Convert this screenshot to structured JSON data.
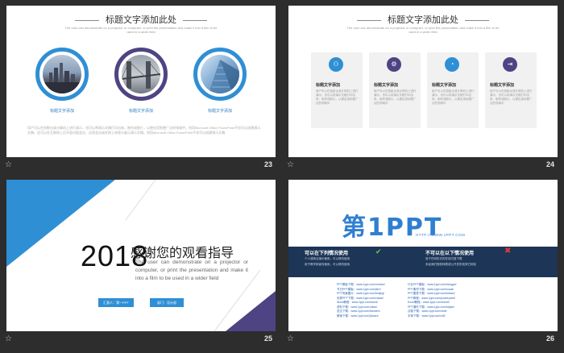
{
  "slides": [
    {
      "number": "23",
      "title": "标题文字添加此处",
      "subtitle": "The user can demonstrate on a projector or computer, or print the presentation and make it into a film to be used in a wider field",
      "captions": [
        "标题文字添加",
        "标题文字添加",
        "标题文字添加"
      ],
      "paragraph": "用户可以在投影仪或计算机上进行演示，也可以将演示文稿打印出来，制作成胶片，以便应用到更广泛的领域中。利用Microsoft Office PowerPoint不仅可以创建演示文稿，还可以在互联网上召开面对面会议、远程会议或在网上给观众展示演示文稿。利用Microsoft Office PowerPoint不仅可以创建演示文稿"
    },
    {
      "number": "24",
      "title": "标题文字添加此处",
      "subtitle": "The user can demonstrate on a projector or computer, or print the presentation and make it into a film to be used in a wider field",
      "cards": [
        {
          "title": "标题文字添加",
          "text": "用户可以在投影仪或计算机上进行演示，也可以将演示文稿打印出来，制作成胶片，以便应用到更广泛的领域中"
        },
        {
          "title": "标题文字添加",
          "text": "用户可以在投影仪或计算机上进行演示，也可以将演示文稿打印出来，制作成胶片，以便应用到更广泛的领域中"
        },
        {
          "title": "标题文字添加",
          "text": "用户可以在投影仪或计算机上进行演示，也可以将演示文稿打印出来，制作成胶片，以便应用到更广泛的领域中"
        },
        {
          "title": "标题文字添加",
          "text": "用户可以在投影仪或计算机上进行演示，也可以将演示文稿打印出来，制作成胶片，以便应用到更广泛的领域中"
        }
      ]
    },
    {
      "number": "25",
      "year": "2018",
      "heading": "感谢您的观看指导",
      "body": "The user can demonstrate on a projector or computer, or print the presentation and make it into a film to be used in a wider field",
      "btn1": "汇报人：第一PPT",
      "btn2": "部门：设计部"
    },
    {
      "number": "26",
      "logo_main": "第1PPT",
      "logo_url": "HTTP://WWW.1PPT.COM",
      "left_head": "可以在下列情况使用",
      "left_lines": [
        "个人或商业演示使用，可以修改使用",
        "用于教学和宣传使用，可以修改使用"
      ],
      "right_head": "不可以在以下情况使用",
      "right_lines": [
        "用于任何形式的在线付费下载",
        "未经我们授权转载或公开发布到其它网站"
      ],
      "links_left": [
        "PPT模板下载：www.1ppt.com/moban/",
        "节日PPT模板：www.1ppt.com/jieri/",
        "PPT背景图片：www.1ppt.com/beijing/",
        "优秀PPT下载：www.1ppt.com/xiazai/",
        "Word教程：www.1ppt.com/word/",
        "资料下载：www.1ppt.com/ziliao/",
        "范文下载：www.1ppt.com/fanwen/",
        "教案下载：www.1ppt.com/jiaoan/"
      ],
      "links_right": [
        "行业PPT模板：www.1ppt.com/hangye/",
        "PPT素材下载：www.1ppt.com/sucai/",
        "PPT图表下载：www.1ppt.com/tubiao/",
        "PPT教程：www.1ppt.com/powerpoint/",
        "Excel教程：www.1ppt.com/excel/",
        "PPT课件下载：www.1ppt.com/kejian/",
        "试卷下载：www.1ppt.com/shiti/",
        "字体下载：www.1ppt.com/ziti/"
      ]
    }
  ]
}
